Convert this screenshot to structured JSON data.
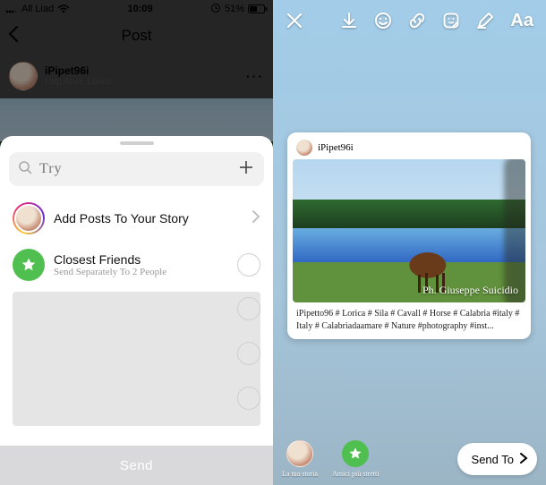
{
  "status": {
    "carrier": "All Liad",
    "time": "10:09",
    "battery": "51%"
  },
  "left": {
    "title": "Post",
    "feed": {
      "username": "iPipet96i",
      "subline": "Lalp Arvo, Lorica",
      "more": "···"
    },
    "search_placeholder": "Try",
    "row_story": "Add Posts To Your Story",
    "row_close_title": "Closest Friends",
    "row_close_sub": "Send Separately To 2 People",
    "send": "Send"
  },
  "right": {
    "toolbar_text": "Aa",
    "card_username": "iPipet96i",
    "signature": "Ph. Giuseppe Suicidio",
    "caption": "iPipetto96 # Lorica # Sila # Cavall # Horse # Calabria #italy # Italy # Calabriadaamare # Nature #photography #inst...",
    "dest_story": "La tua storia",
    "dest_close": "Amici più stretti",
    "send_to": "Send To"
  }
}
